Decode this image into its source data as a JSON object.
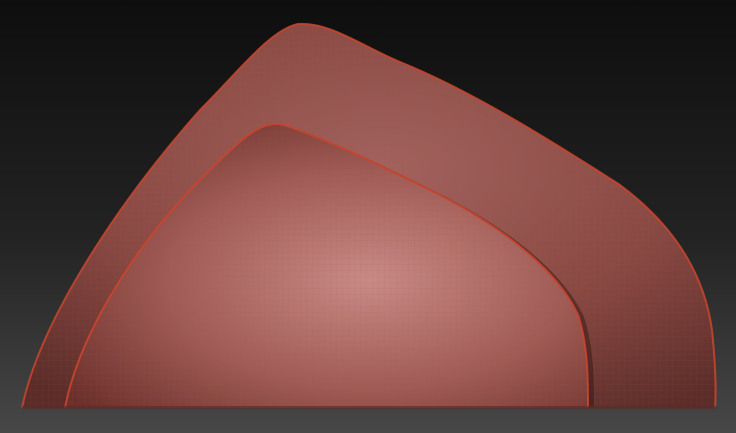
{
  "scene": {
    "colors": {
      "background_top": "#0e0e0e",
      "background_bottom": "#474747",
      "outer_shell_highlight": "#a2625d",
      "outer_shell_base": "#8a4a44",
      "outer_shell_shadow": "#5a2d29",
      "inner_shell_highlight": "#c98a85",
      "inner_shell_base": "#9f5b55",
      "inner_shell_shadow": "#6b302b",
      "rim_edge": "#c9452e",
      "wireframe": "#c14634"
    },
    "wireframe_visible": true
  }
}
